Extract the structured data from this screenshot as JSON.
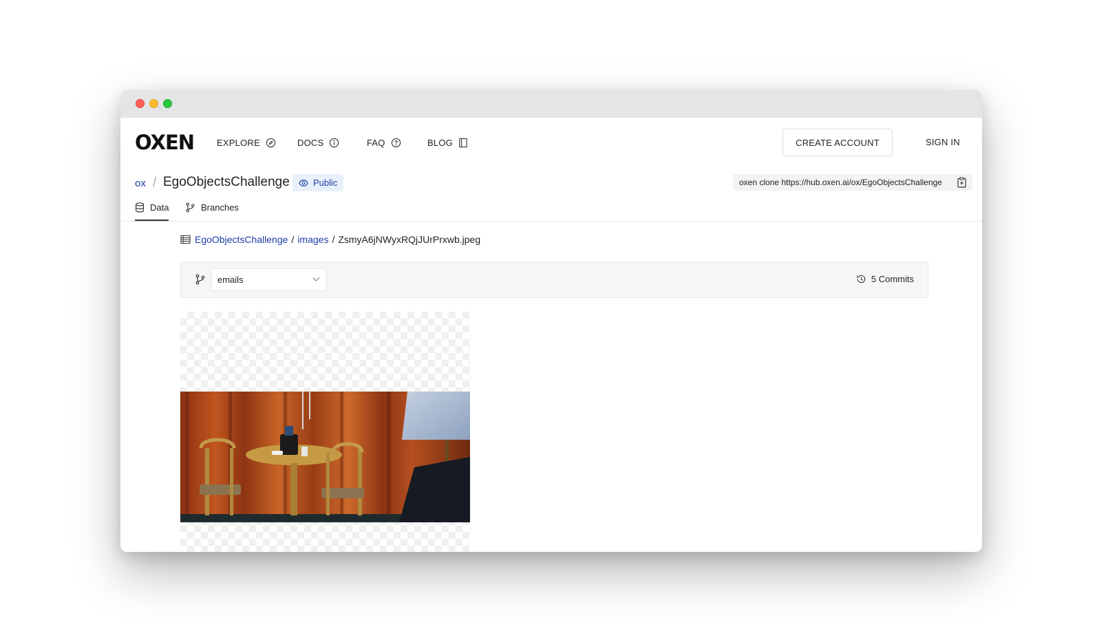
{
  "nav": {
    "logo": "OXEN",
    "explore": "EXPLORE",
    "docs": "DOCS",
    "faq": "FAQ",
    "blog": "BLOG",
    "create_account": "CREATE ACCOUNT",
    "sign_in": "SIGN IN"
  },
  "repo": {
    "owner": "ox",
    "separator": "/",
    "name": "EgoObjectsChallenge",
    "visibility": "Public",
    "clone_command": "oxen clone https://hub.oxen.ai/ox/EgoObjectsChallenge"
  },
  "tabs": [
    {
      "label": "Data",
      "active": true
    },
    {
      "label": "Branches",
      "active": false
    }
  ],
  "breadcrumb": {
    "repo": "EgoObjectsChallenge",
    "folder": "images",
    "file": "ZsmyA6jNWyxRQjJUrPrxwb.jpeg",
    "sep": "/"
  },
  "branch_bar": {
    "selected_branch": "emails",
    "commits": "5 Commits"
  },
  "colors": {
    "accent": "#1a3ea6",
    "badge_bg": "#e8f0fa"
  }
}
